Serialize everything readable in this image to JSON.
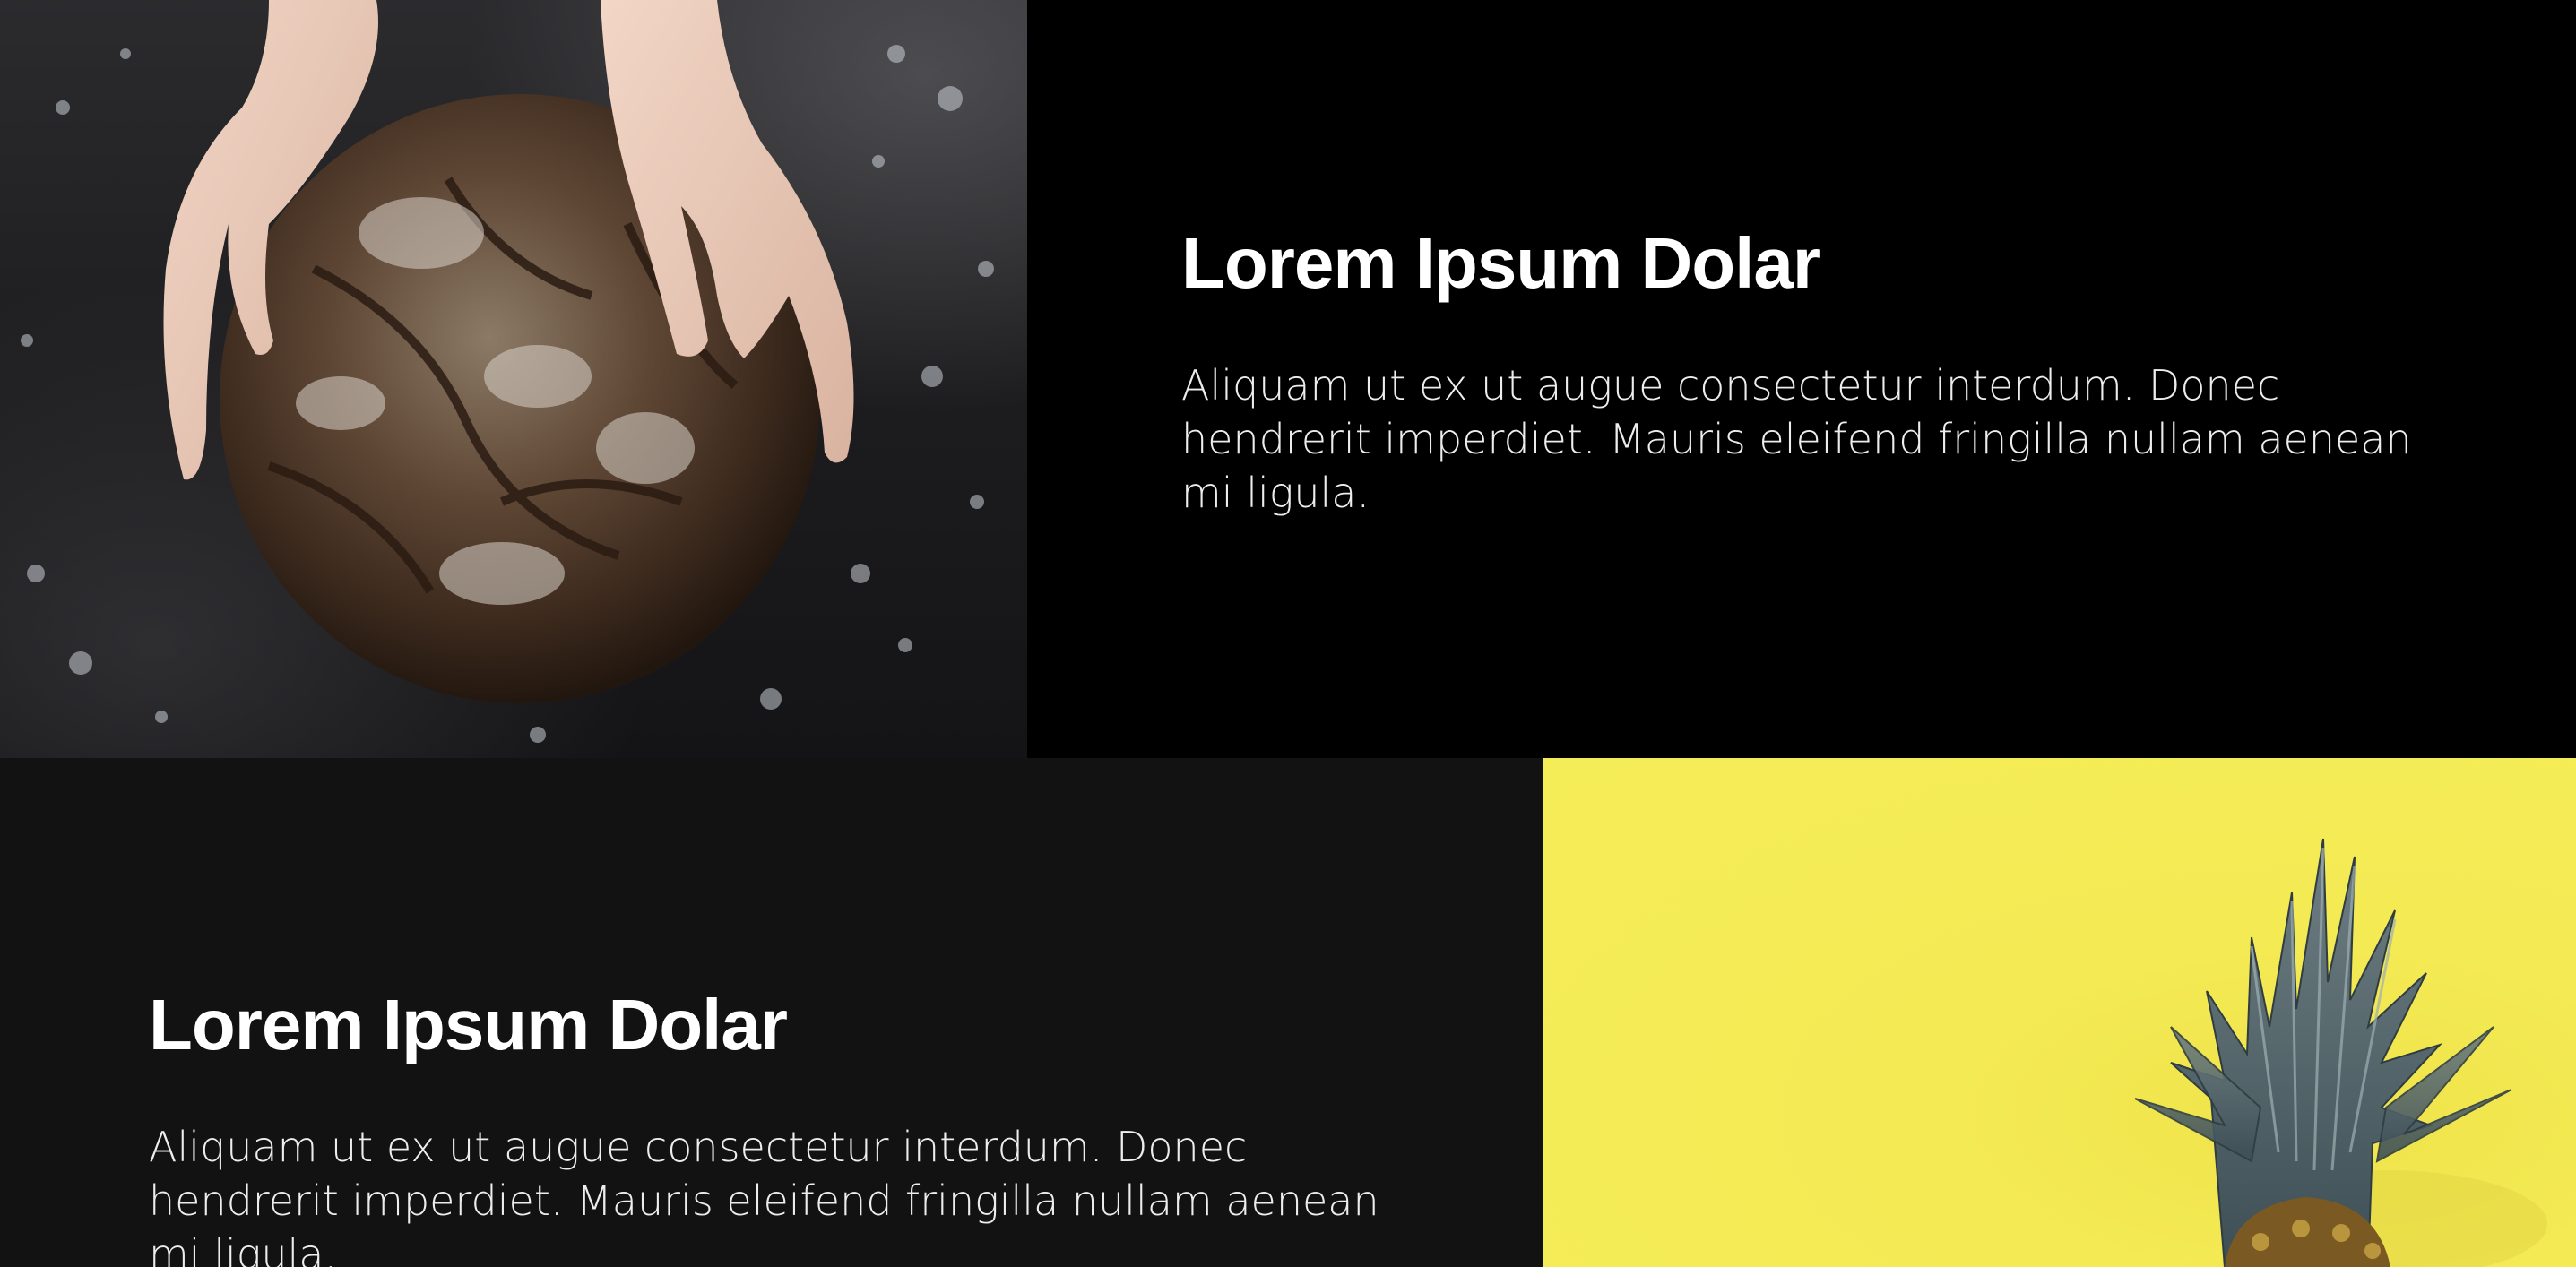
{
  "sections": [
    {
      "heading": "Lorem Ipsum Dolar",
      "body": "Aliquam ut ex ut augue consectetur interdum. Donec hendrerit imperdiet. Mauris eleifend fringilla nullam aenean mi ligula.",
      "image": "bread-photo",
      "background": "#000000"
    },
    {
      "heading": "Lorem Ipsum Dolar",
      "body": "Aliquam ut ex ut augue consectetur interdum. Donec hendrerit imperdiet. Mauris eleifend fringilla nullam aenean mi ligula.",
      "image": "pineapple-photo",
      "background": "#121212",
      "image_background": "#f5ed58"
    }
  ]
}
